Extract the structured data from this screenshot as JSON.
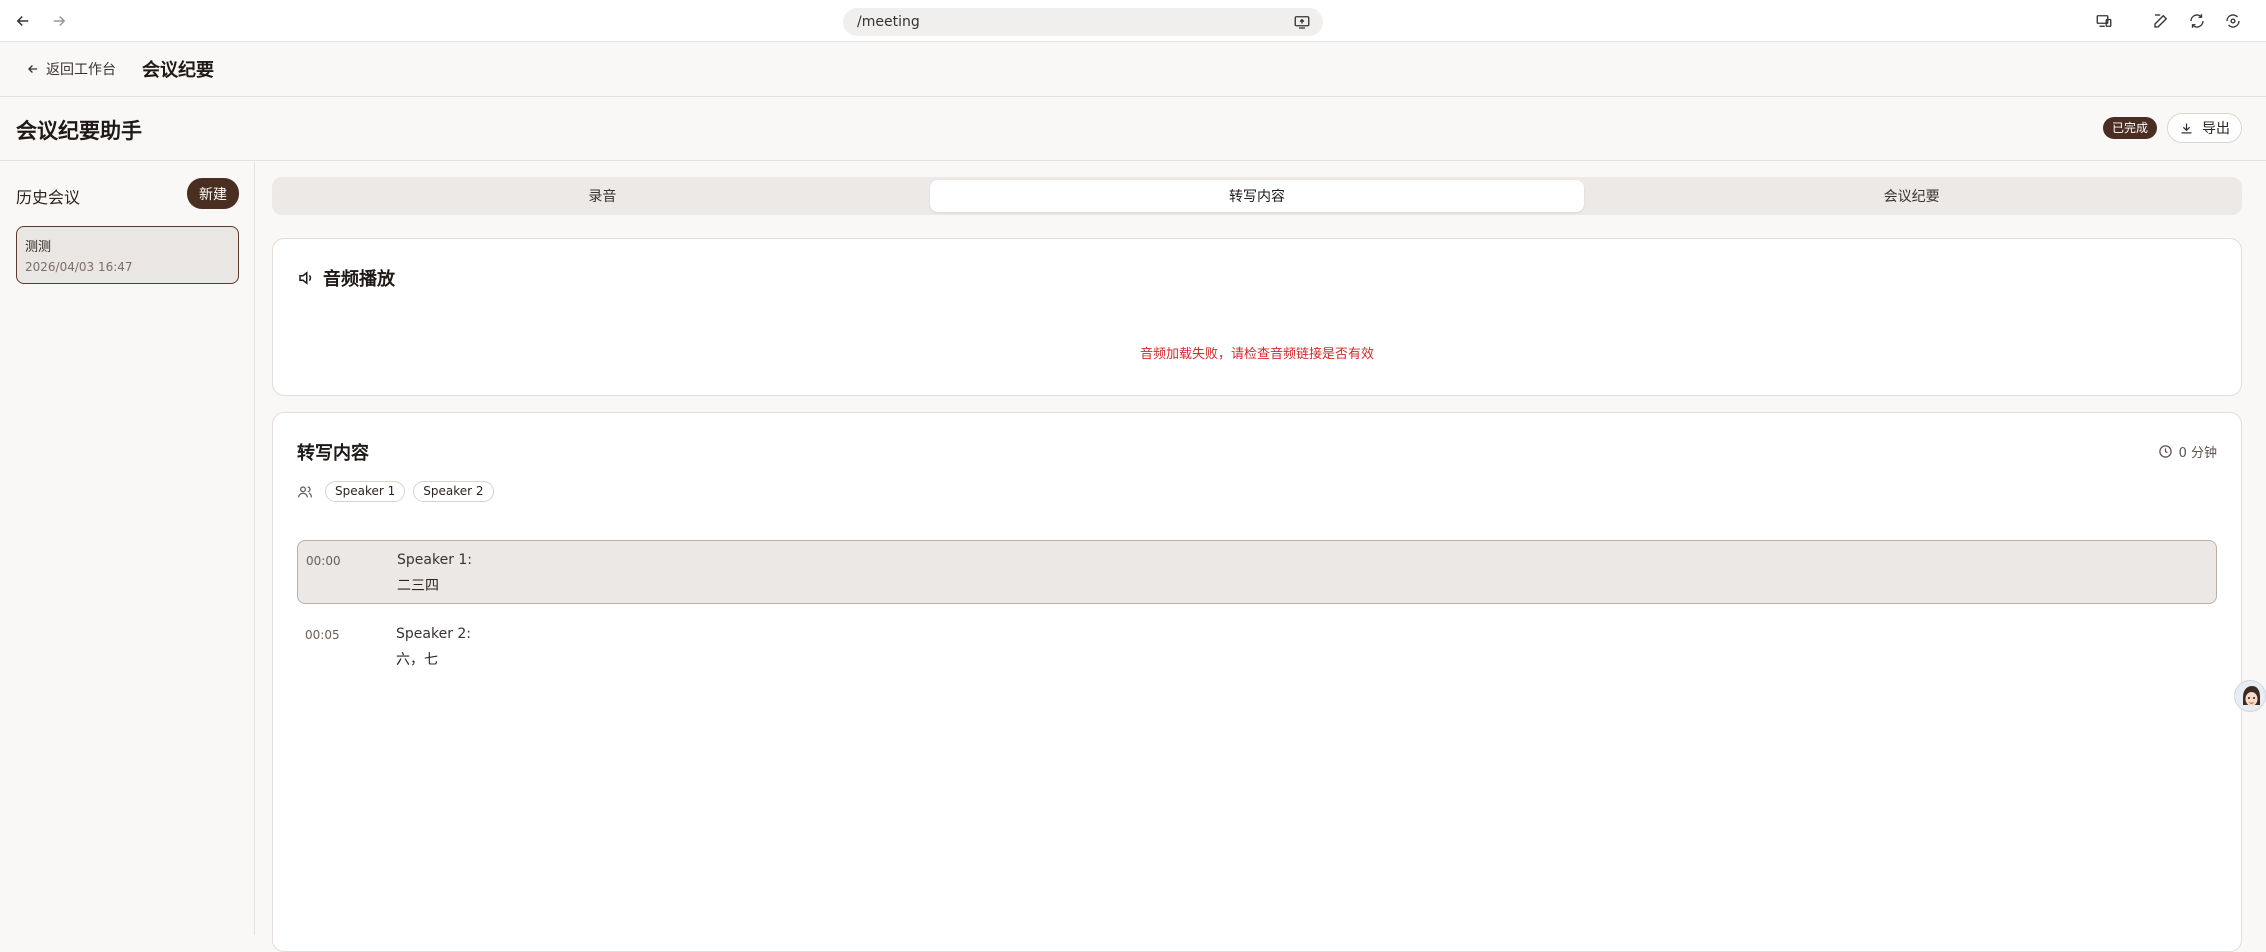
{
  "browser": {
    "url": "/meeting"
  },
  "header": {
    "back_label": "返回工作台",
    "title": "会议纪要"
  },
  "page": {
    "title": "会议纪要助手",
    "status": "已完成",
    "export_label": "导出"
  },
  "sidebar": {
    "title": "历史会议",
    "new_label": "新建",
    "meetings": [
      {
        "name": "测测",
        "time": "2026/04/03 16:47"
      }
    ]
  },
  "tabs": [
    {
      "label": "录音",
      "active": false
    },
    {
      "label": "转写内容",
      "active": true
    },
    {
      "label": "会议纪要",
      "active": false
    }
  ],
  "audio": {
    "title": "音频播放",
    "error": "音频加载失败，请检查音频链接是否有效"
  },
  "transcript": {
    "title": "转写内容",
    "duration": "0 分钟",
    "speakers": [
      "Speaker 1",
      "Speaker 2"
    ],
    "segments": [
      {
        "time": "00:00",
        "speaker": "Speaker 1:",
        "text": "二三四",
        "active": true
      },
      {
        "time": "00:05",
        "speaker": "Speaker 2:",
        "text": "六，七",
        "active": false
      }
    ]
  },
  "colors": {
    "accent": "#4a2e22",
    "error": "#d6282b",
    "background": "#faf8f6"
  }
}
